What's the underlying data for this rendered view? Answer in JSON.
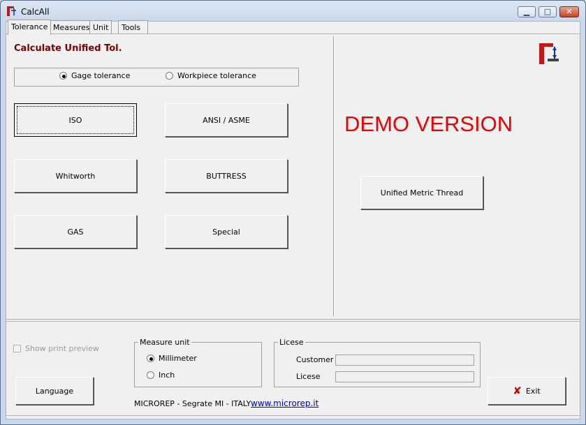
{
  "window": {
    "title": "CalcAll"
  },
  "tabs": [
    {
      "label": "Tolerance"
    },
    {
      "label": "Measures"
    },
    {
      "label": "Unit"
    },
    {
      "label": "Tools"
    }
  ],
  "tolerance_panel": {
    "heading": "Calculate Unified Tol.",
    "radios": {
      "gage": "Gage tolerance",
      "workpiece": "Workpiece tolerance",
      "selected": "gage"
    },
    "buttons": {
      "iso": "ISO",
      "ansi": "ANSI / ASME",
      "whitworth": "Whitworth",
      "buttress": "BUTTRESS",
      "gas": "GAS",
      "special": "Special"
    },
    "demo_text": "DEMO VERSION",
    "unified_metric_button": "Unified Metric Thread"
  },
  "bottom": {
    "show_print_preview": "Show print preview",
    "language_button": "Language",
    "measure_unit": {
      "label": "Measure unit",
      "millimeter": "Millimeter",
      "inch": "Inch",
      "selected": "millimeter"
    },
    "license": {
      "label": "Licese",
      "customer_label": "Customer",
      "license_label": "Licese",
      "customer_value": "",
      "license_value": ""
    },
    "company": "MICROREP - Segrate MI - ITALY",
    "website": "www.microrep.it",
    "exit_button": "Exit"
  },
  "colors": {
    "heading": "#7a0000",
    "demo": "#ee0000",
    "link": "#0000cc",
    "exit_icon": "#cc0000"
  }
}
